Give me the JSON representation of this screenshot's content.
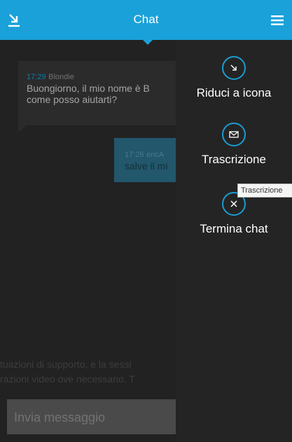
{
  "header": {
    "title": "Chat",
    "minimize_icon": "minimize-arrow-icon",
    "menu_icon": "hamburger-menu-icon",
    "accent_color": "#1aa1d9"
  },
  "messages": [
    {
      "time": "17:29",
      "sender": "Blondie",
      "text_line1": "Buongiorno, il mio nome è B",
      "text_line2": "come posso aiutarti?"
    },
    {
      "time": "17:26",
      "sender": "ericA",
      "text_line1": "salve il mi"
    }
  ],
  "disclaimer": {
    "line1": "tuazioni di supporto, e la sessi",
    "line2": "razioni video ove necessario. T"
  },
  "input": {
    "placeholder": "Invia messaggio"
  },
  "side_menu": {
    "items": [
      {
        "label": "Riduci a icona",
        "icon": "minimize-circle-icon"
      },
      {
        "label": "Trascrizione",
        "icon": "envelope-circle-icon"
      },
      {
        "label": "Termina chat",
        "icon": "close-circle-icon"
      }
    ]
  },
  "tooltip": {
    "text": "Trascrizione"
  }
}
